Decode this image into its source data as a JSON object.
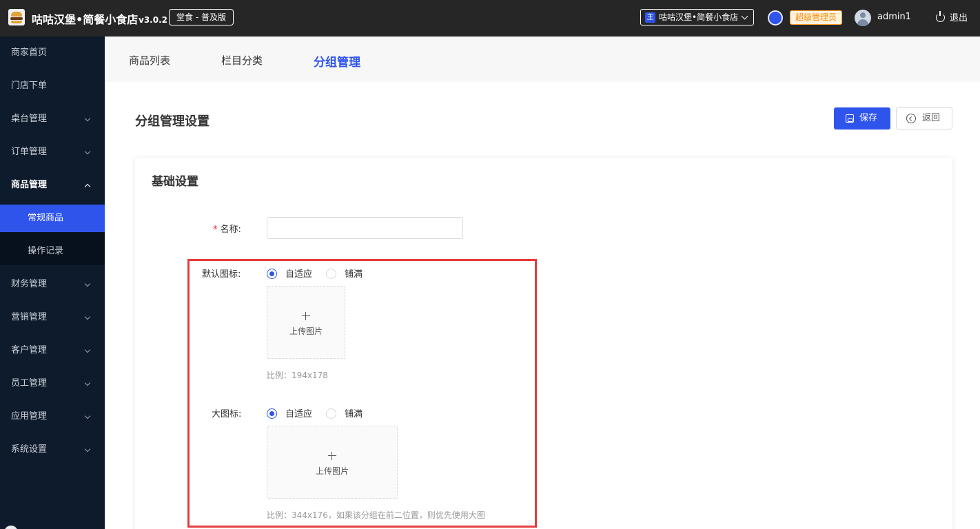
{
  "header": {
    "app_title": "咕咕汉堡•简餐小食店",
    "version": "v3.0.2",
    "edition": "堂食 - 普及版",
    "store_tag": "主",
    "store_name": "咕咕汉堡•简餐小食店",
    "role": "超级管理员",
    "username": "admin1",
    "logout": "退出",
    "status_color": "#2f54eb",
    "role_color": "#ff8a00"
  },
  "sidebar": {
    "items": [
      {
        "label": "商家首页"
      },
      {
        "label": "门店下单"
      },
      {
        "label": "桌台管理"
      },
      {
        "label": "订单管理"
      },
      {
        "label": "商品管理"
      },
      {
        "label": "财务管理"
      },
      {
        "label": "营销管理"
      },
      {
        "label": "客户管理"
      },
      {
        "label": "员工管理"
      },
      {
        "label": "应用管理"
      },
      {
        "label": "系统设置"
      }
    ],
    "subitems": [
      {
        "label": "常规商品",
        "active": true
      },
      {
        "label": "操作记录",
        "active": false
      }
    ],
    "active_color": "#2f54eb"
  },
  "tabs": [
    {
      "label": "商品列表"
    },
    {
      "label": "栏目分类"
    },
    {
      "label": "分组管理",
      "active": true
    }
  ],
  "page": {
    "title": "分组管理设置",
    "save_label": "保存",
    "back_label": "返回"
  },
  "form": {
    "section_title": "基础设置",
    "name_label": "名称:",
    "name_value": "",
    "default_icon_label": "默认图标:",
    "default_icon_options": [
      "自适应",
      "铺满"
    ],
    "default_icon_selected": "自适应",
    "default_upload_label": "上传图片",
    "default_ratio_hint": "比例：194x178",
    "large_icon_label": "大图标:",
    "large_icon_options": [
      "自适应",
      "铺满"
    ],
    "large_icon_selected": "自适应",
    "large_upload_label": "上传图片",
    "large_ratio_hint": "比例：344x176，如果该分组在前二位置，则优先使用大图"
  }
}
